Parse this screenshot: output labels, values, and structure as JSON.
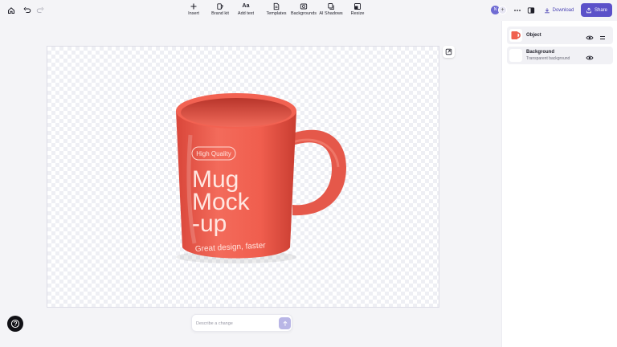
{
  "toolbar": {
    "tools": [
      {
        "label": "Insert",
        "icon": "plus-icon"
      },
      {
        "label": "Brand kit",
        "icon": "brand-kit-icon"
      },
      {
        "label": "Add text",
        "icon": "text-icon"
      },
      {
        "label": "Templates",
        "icon": "templates-icon"
      },
      {
        "label": "Backgrounds",
        "icon": "backgrounds-icon"
      },
      {
        "label": "AI Shadows",
        "icon": "shadows-icon"
      },
      {
        "label": "Resize",
        "icon": "resize-icon"
      }
    ],
    "avatar_initial": "N",
    "download_label": "Download",
    "share_label": "Share"
  },
  "canvas": {
    "mug": {
      "badge": "High Quality",
      "title_lines": [
        "Mug",
        "Mock",
        "-up"
      ],
      "tagline": "Great design, faster"
    }
  },
  "prompt": {
    "placeholder": "Describe a change"
  },
  "layers": [
    {
      "name": "Object",
      "subtitle": ""
    },
    {
      "name": "Background",
      "subtitle": "Transparent background"
    }
  ],
  "colors": {
    "accent": "#5b51c9",
    "mug": "#f0604f",
    "canvas_bg": "#f4f4f7"
  }
}
